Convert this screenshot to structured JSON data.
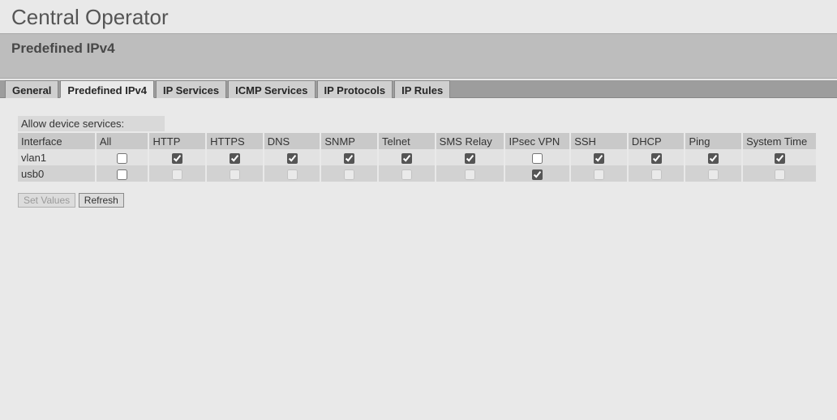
{
  "page_title": "Central Operator",
  "subheader": "Predefined IPv4",
  "tabs": [
    {
      "label": "General",
      "active": false
    },
    {
      "label": "Predefined IPv4",
      "active": true
    },
    {
      "label": "IP Services",
      "active": false
    },
    {
      "label": "ICMP Services",
      "active": false
    },
    {
      "label": "IP Protocols",
      "active": false
    },
    {
      "label": "IP Rules",
      "active": false
    }
  ],
  "section_label": "Allow device services:",
  "columns": [
    "Interface",
    "All",
    "HTTP",
    "HTTPS",
    "DNS",
    "SNMP",
    "Telnet",
    "SMS Relay",
    "IPsec VPN",
    "SSH",
    "DHCP",
    "Ping",
    "System Time"
  ],
  "rows": [
    {
      "interface": "vlan1",
      "values": {
        "All": false,
        "HTTP": true,
        "HTTPS": true,
        "DNS": true,
        "SNMP": true,
        "Telnet": true,
        "SMS Relay": true,
        "IPsec VPN": false,
        "SSH": true,
        "DHCP": true,
        "Ping": true,
        "System Time": true
      },
      "disabled": {
        "All": false,
        "HTTP": false,
        "HTTPS": false,
        "DNS": false,
        "SNMP": false,
        "Telnet": false,
        "SMS Relay": false,
        "IPsec VPN": false,
        "SSH": false,
        "DHCP": false,
        "Ping": false,
        "System Time": false
      }
    },
    {
      "interface": "usb0",
      "values": {
        "All": false,
        "HTTP": false,
        "HTTPS": false,
        "DNS": false,
        "SNMP": false,
        "Telnet": false,
        "SMS Relay": false,
        "IPsec VPN": true,
        "SSH": false,
        "DHCP": false,
        "Ping": false,
        "System Time": false
      },
      "disabled": {
        "All": false,
        "HTTP": true,
        "HTTPS": true,
        "DNS": true,
        "SNMP": true,
        "Telnet": true,
        "SMS Relay": true,
        "IPsec VPN": false,
        "SSH": true,
        "DHCP": true,
        "Ping": true,
        "System Time": true
      }
    }
  ],
  "buttons": {
    "set_values": "Set Values",
    "refresh": "Refresh",
    "set_values_disabled": true
  }
}
